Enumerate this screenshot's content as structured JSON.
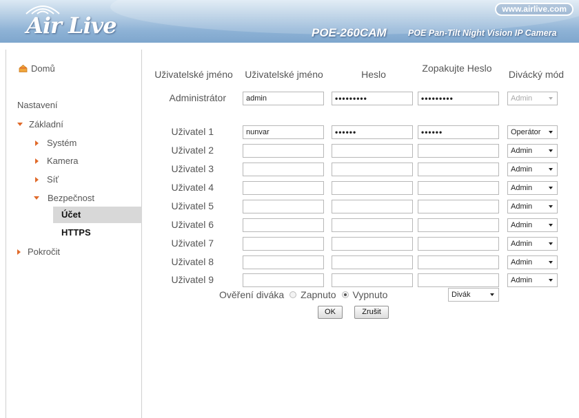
{
  "header": {
    "logo_text": "Air Live",
    "url": "www.airlive.com",
    "model": "POE-260CAM",
    "model_desc": "POE Pan-Tilt Night Vision IP Camera"
  },
  "sidebar": {
    "home": "Domů",
    "section": "Nastavení",
    "basic": "Základní",
    "system": "Systém",
    "camera": "Kamera",
    "network": "Síť",
    "security": "Bezpečnost",
    "account": "Účet",
    "https": "HTTPS",
    "advanced": "Pokročit"
  },
  "table": {
    "headers": {
      "username_label": "Uživatelské jméno",
      "username": "Uživatelské jméno",
      "password": "Heslo",
      "confirm": "Zopakujte Heslo",
      "mode": "Divácký mód"
    },
    "admin": {
      "label": "Administrátor",
      "username": "admin",
      "password": "•••••••••",
      "confirm": "•••••••••",
      "mode": "Admin"
    },
    "users": [
      {
        "label": "Uživatel 1",
        "username": "nunvar",
        "password": "••••••",
        "confirm": "••••••",
        "mode": "Operátor"
      },
      {
        "label": "Uživatel 2",
        "username": "",
        "password": "",
        "confirm": "",
        "mode": "Admin"
      },
      {
        "label": "Uživatel 3",
        "username": "",
        "password": "",
        "confirm": "",
        "mode": "Admin"
      },
      {
        "label": "Uživatel 4",
        "username": "",
        "password": "",
        "confirm": "",
        "mode": "Admin"
      },
      {
        "label": "Uživatel 5",
        "username": "",
        "password": "",
        "confirm": "",
        "mode": "Admin"
      },
      {
        "label": "Uživatel 6",
        "username": "",
        "password": "",
        "confirm": "",
        "mode": "Admin"
      },
      {
        "label": "Uživatel 7",
        "username": "",
        "password": "",
        "confirm": "",
        "mode": "Admin"
      },
      {
        "label": "Uživatel 8",
        "username": "",
        "password": "",
        "confirm": "",
        "mode": "Admin"
      },
      {
        "label": "Uživatel 9",
        "username": "",
        "password": "",
        "confirm": "",
        "mode": "Admin"
      }
    ]
  },
  "viewer_auth": {
    "label": "Ověření diváka",
    "on": "Zapnuto",
    "off": "Vypnuto",
    "selected": "off",
    "type": "Divák"
  },
  "buttons": {
    "ok": "OK",
    "cancel": "Zrušit"
  },
  "colors": {
    "accent_orange": "#e06a2a",
    "header_blue": "#8fb3d6"
  }
}
